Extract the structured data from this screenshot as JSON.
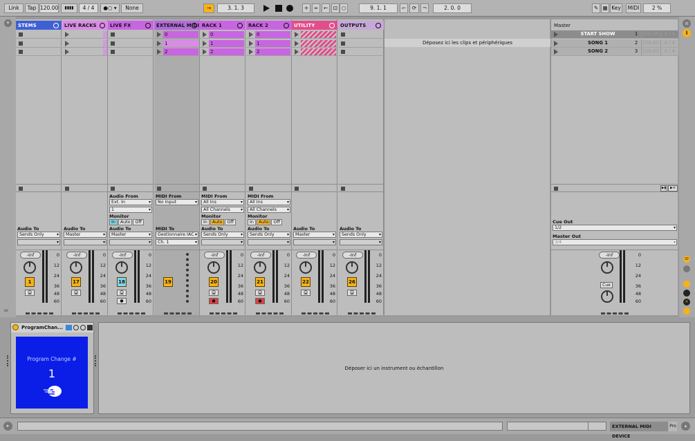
{
  "toolbar": {
    "link": "Link",
    "tap": "Tap",
    "tempo": "120.00",
    "signature": "4 / 4",
    "metro": "1 Bar",
    "quant": "None",
    "position": "3. 1. 3",
    "loop_start": "9. 1. 1",
    "loop_len": "2. 0. 0",
    "key": "Key",
    "midi": "MIDI",
    "cpu": "2 %"
  },
  "tracks": [
    {
      "name": "STEMS",
      "color": "#3f5fd4",
      "textcolor": "#ffffff",
      "clips": [],
      "io_label": "Audio To",
      "io_value": "Sends Only",
      "num": "1",
      "numcolor": "#f5b21a"
    },
    {
      "name": "LIVE RACKS",
      "color": "#d98be6",
      "textcolor": "#111111",
      "clips": [],
      "io_label": "Audio To",
      "io_value": "Master",
      "num": "17",
      "numcolor": "#f5b21a"
    },
    {
      "name": "LIVE FX",
      "color": "#c865e0",
      "textcolor": "#111111",
      "clips": [],
      "io_from_label": "Audio From",
      "io_from": "Ext. In",
      "io_from2": "1",
      "monitor": "Monitor",
      "mon_in": "In",
      "mon_auto": "Auto",
      "mon_off": "Off",
      "io_label": "Audio To",
      "io_value": "Master",
      "num": "18",
      "numcolor": "#7fd7ee"
    },
    {
      "name": "EXTERNAL MIDI",
      "color": "#b26ad8",
      "textcolor": "#111111",
      "clips": [
        "0",
        "1",
        "2"
      ],
      "io_from_label": "MIDI From",
      "io_from": "No Input",
      "io_label": "MIDI To",
      "io_value": "Gestionnaire IAC",
      "io_value2": "Ch. 1",
      "num": "19",
      "numcolor": "#f5b21a"
    },
    {
      "name": "RACK 1",
      "color": "#c865e0",
      "textcolor": "#111111",
      "clips": [
        "0",
        "1",
        "2"
      ],
      "io_from_label": "MIDI From",
      "io_from": "All Ins",
      "io_from2": "All Channels",
      "monitor": "Monitor",
      "mon_in": "In",
      "mon_auto": "Auto",
      "mon_off": "Off",
      "io_label": "Audio To",
      "io_value": "Sends Only",
      "num": "20",
      "numcolor": "#f5b21a"
    },
    {
      "name": "RACK 2",
      "color": "#c865e0",
      "textcolor": "#111111",
      "clips": [
        "0",
        "1",
        "2"
      ],
      "io_from_label": "MIDI From",
      "io_from": "All Ins",
      "io_from2": "All Channels",
      "monitor": "Monitor",
      "mon_in": "In",
      "mon_auto": "Auto",
      "mon_off": "Off",
      "io_label": "Audio To",
      "io_value": "Sends Only",
      "num": "21",
      "numcolor": "#f5b21a"
    },
    {
      "name": "UTILITY",
      "color": "#e14e8c",
      "textcolor": "#ffffff",
      "clips": [],
      "io_label": "Audio To",
      "io_value": "Master",
      "num": "22",
      "numcolor": "#f5b21a"
    },
    {
      "name": "OUTPUTS",
      "color": "#c6a8d8",
      "textcolor": "#111111",
      "clips": [],
      "io_label": "Audio To",
      "io_value": "Sends Only",
      "num": "26",
      "numcolor": "#f5b21a"
    }
  ],
  "mixer": {
    "vol": "-Inf",
    "scale": [
      "0",
      "12",
      "24",
      "36",
      "48",
      "60"
    ]
  },
  "droparea": {
    "text": "Déposez ici les clips et périphériques"
  },
  "master": {
    "title": "Master",
    "scenes": [
      {
        "name": "START SHOW",
        "n": "1",
        "tempo": "120.00",
        "sig": "4 / 4"
      },
      {
        "name": "SONG 1",
        "n": "2",
        "tempo": "120.00",
        "sig": "4 / 4"
      },
      {
        "name": "SONG 2",
        "n": "3",
        "tempo": "120.00",
        "sig": "4 / 4"
      }
    ],
    "cue_out_label": "Cue Out",
    "cue_out": "1/2",
    "master_out_label": "Master Out",
    "master_out": "3/4",
    "vol": "-Inf",
    "cue": "Cue"
  },
  "device": {
    "title": "ProgramChan...",
    "label": "Program Change #",
    "value": "1"
  },
  "dropinst": {
    "text": "Déposer ici un instrument ou échantillon"
  },
  "status": {
    "track": "EXTERNAL MIDI DEVICE",
    "pro": "Pro"
  }
}
